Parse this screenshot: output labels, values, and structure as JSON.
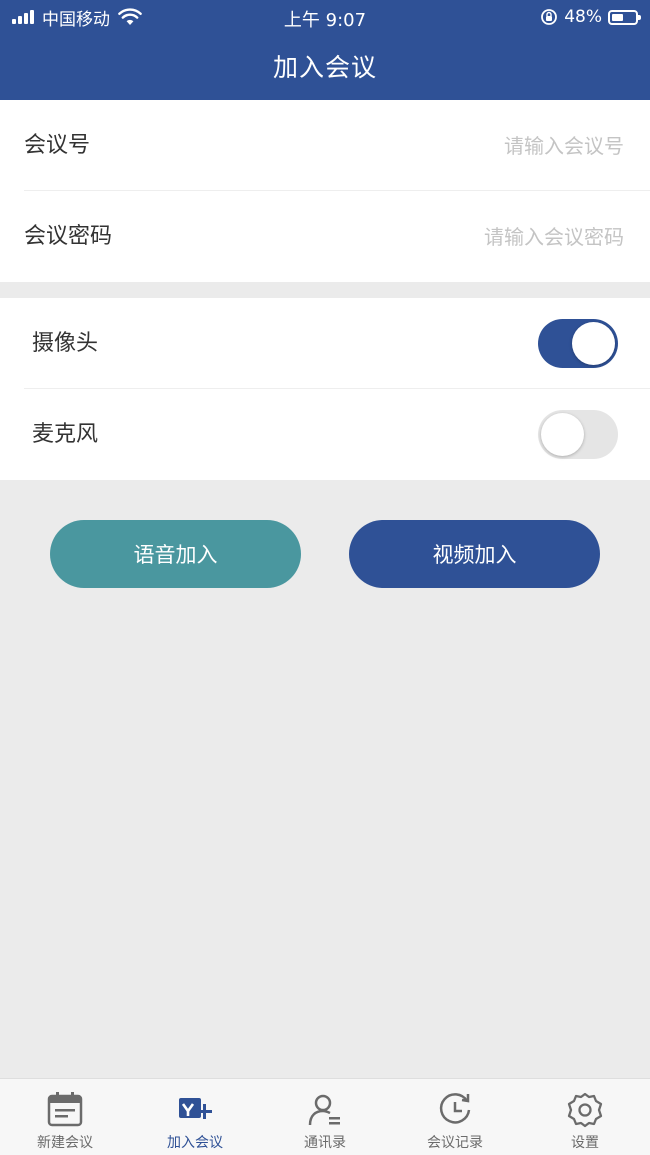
{
  "status_bar": {
    "carrier": "中国移动",
    "time": "上午 9:07",
    "battery_percent": "48%",
    "battery_level": 0.48,
    "icons": [
      "signal-icon",
      "wifi-icon",
      "rotation-lock-icon",
      "battery-icon"
    ]
  },
  "nav": {
    "title": "加入会议"
  },
  "form": {
    "meeting_number": {
      "label": "会议号",
      "value": "",
      "placeholder": "请输入会议号"
    },
    "meeting_password": {
      "label": "会议密码",
      "value": "",
      "placeholder": "请输入会议密码"
    }
  },
  "toggles": {
    "camera": {
      "label": "摄像头",
      "on": true
    },
    "microphone": {
      "label": "麦克风",
      "on": false
    }
  },
  "buttons": {
    "voice_join": "语音加入",
    "video_join": "视频加入"
  },
  "tabbar": {
    "items": [
      {
        "label": "新建会议",
        "icon": "calendar-icon",
        "active": false
      },
      {
        "label": "加入会议",
        "icon": "join-meeting-icon",
        "active": true
      },
      {
        "label": "通讯录",
        "icon": "contacts-icon",
        "active": false
      },
      {
        "label": "会议记录",
        "icon": "history-clock-icon",
        "active": false
      },
      {
        "label": "设置",
        "icon": "gear-icon",
        "active": false
      }
    ]
  },
  "colors": {
    "primary": "#2f5196",
    "voice_button": "#4a979f",
    "background": "#ebebeb",
    "tab_inactive": "#6b6b6b"
  }
}
